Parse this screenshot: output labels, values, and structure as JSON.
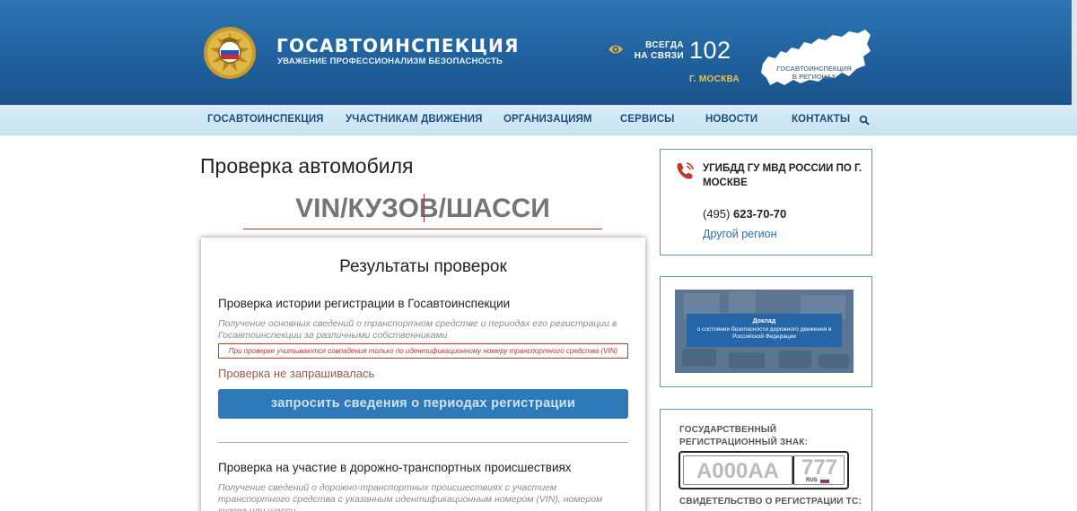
{
  "header": {
    "brand_name": "ГОСАВТОИНСПЕКЦИЯ",
    "brand_tagline": "УВАЖЕНИЕ ПРОФЕССИОНАЛИЗМ БЕЗОПАСНОСТЬ",
    "always_line1": "ВСЕГДА",
    "always_line2": "НА СВЯЗИ",
    "hotline_number": "102",
    "hotline_city": "Г. МОСКВА",
    "map_label_line1": "ГОСАВТОИНСПЕКЦИЯ",
    "map_label_line2": "В РЕГИОНАХ"
  },
  "nav": {
    "items": [
      {
        "label": "ГОСАВТОИНСПЕКЦИЯ"
      },
      {
        "label": "УЧАСТНИКАМ ДВИЖЕНИЯ"
      },
      {
        "label": "ОРГАНИЗАЦИЯМ"
      },
      {
        "label": "СЕРВИСЫ"
      },
      {
        "label": "НОВОСТИ"
      },
      {
        "label": "КОНТАКТЫ"
      }
    ]
  },
  "main": {
    "page_title": "Проверка автомобиля",
    "vin_placeholder": "VIN/КУЗОВ/ШАССИ",
    "results_title": "Результаты проверок",
    "registration": {
      "title": "Проверка истории регистрации в Госавтоинспекции",
      "description": "Получение основных сведений о транспортном средстве и периодах его регистрации в Госавтоинспекции за различными собственниками",
      "vin_note": "При проверке учитываются совпадения только по идентификационному номеру транспортного средства (VIN)",
      "status": "Проверка не запрашивалась",
      "button_label": "запросить сведения о периодах регистрации"
    },
    "accidents": {
      "title": "Проверка на участие в дорожно-транспортных происшествиях",
      "description": "Получение сведений о дорожно-транспортных происшествиях с участием транспортного средства с указанным идентификационным номером (VIN), номером кузова или шасси,"
    }
  },
  "sidebar": {
    "contact": {
      "dept_name": "УГИБДД ГУ МВД РОССИИ ПО Г. МОСКВЕ",
      "phone_code": "(495)",
      "phone_number": "623-70-70",
      "other_region": "Другой регион"
    },
    "report": {
      "title": "Доклад",
      "subtitle": "о состоянии безопасности дорожного движения в Российской Федерации"
    },
    "plate": {
      "caption": "ГОСУДАРСТВЕННЫЙ РЕГИСТРАЦИОННЫЙ ЗНАК:",
      "main": "А000АА",
      "region": "777",
      "rus": "RUS",
      "caption2": "СВИДЕТЕЛЬСТВО О РЕГИСТРАЦИИ ТС:"
    }
  },
  "colors": {
    "header_blue": "#1f5f9c",
    "nav_bg": "#c8e3f3",
    "nav_text": "#1e4d78",
    "button_blue": "#2e7ab8",
    "accent_yellow": "#f0c24b",
    "link_blue": "#2a6fad",
    "alert_red": "#c0392b"
  }
}
